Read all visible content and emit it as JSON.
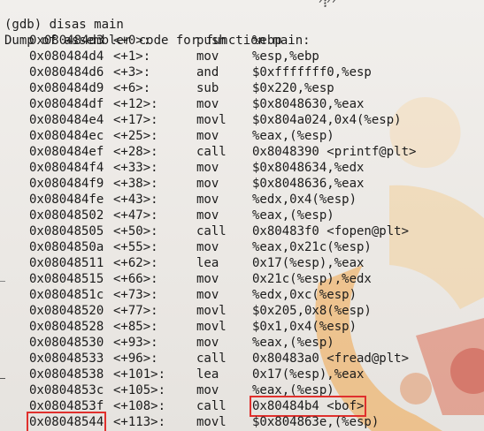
{
  "terminal": {
    "cut_top_text": "ᐟ᎒ᐟᐟ",
    "command_line": "(gdb) disas main",
    "header_line": "Dump of assembler code for function main:",
    "rows": [
      {
        "addr": "0x080484d3",
        "off": "<+0>:",
        "op": "push",
        "args": "%ebp"
      },
      {
        "addr": "0x080484d4",
        "off": "<+1>:",
        "op": "mov",
        "args": "%esp,%ebp"
      },
      {
        "addr": "0x080484d6",
        "off": "<+3>:",
        "op": "and",
        "args": "$0xfffffff0,%esp"
      },
      {
        "addr": "0x080484d9",
        "off": "<+6>:",
        "op": "sub",
        "args": "$0x220,%esp"
      },
      {
        "addr": "0x080484df",
        "off": "<+12>:",
        "op": "mov",
        "args": "$0x8048630,%eax"
      },
      {
        "addr": "0x080484e4",
        "off": "<+17>:",
        "op": "movl",
        "args": "$0x804a024,0x4(%esp)"
      },
      {
        "addr": "0x080484ec",
        "off": "<+25>:",
        "op": "mov",
        "args": "%eax,(%esp)"
      },
      {
        "addr": "0x080484ef",
        "off": "<+28>:",
        "op": "call",
        "args": "0x8048390 <printf@plt>"
      },
      {
        "addr": "0x080484f4",
        "off": "<+33>:",
        "op": "mov",
        "args": "$0x8048634,%edx"
      },
      {
        "addr": "0x080484f9",
        "off": "<+38>:",
        "op": "mov",
        "args": "$0x8048636,%eax"
      },
      {
        "addr": "0x080484fe",
        "off": "<+43>:",
        "op": "mov",
        "args": "%edx,0x4(%esp)"
      },
      {
        "addr": "0x08048502",
        "off": "<+47>:",
        "op": "mov",
        "args": "%eax,(%esp)"
      },
      {
        "addr": "0x08048505",
        "off": "<+50>:",
        "op": "call",
        "args": "0x80483f0 <fopen@plt>"
      },
      {
        "addr": "0x0804850a",
        "off": "<+55>:",
        "op": "mov",
        "args": "%eax,0x21c(%esp)"
      },
      {
        "addr": "0x08048511",
        "off": "<+62>:",
        "op": "lea",
        "args": "0x17(%esp),%eax"
      },
      {
        "addr": "0x08048515",
        "off": "<+66>:",
        "op": "mov",
        "args": "0x21c(%esp),%edx"
      },
      {
        "addr": "0x0804851c",
        "off": "<+73>:",
        "op": "mov",
        "args": "%edx,0xc(%esp)"
      },
      {
        "addr": "0x08048520",
        "off": "<+77>:",
        "op": "movl",
        "args": "$0x205,0x8(%esp)"
      },
      {
        "addr": "0x08048528",
        "off": "<+85>:",
        "op": "movl",
        "args": "$0x1,0x4(%esp)"
      },
      {
        "addr": "0x08048530",
        "off": "<+93>:",
        "op": "mov",
        "args": "%eax,(%esp)"
      },
      {
        "addr": "0x08048533",
        "off": "<+96>:",
        "op": "call",
        "args": "0x80483a0 <fread@plt>"
      },
      {
        "addr": "0x08048538",
        "off": "<+101>:",
        "op": "lea",
        "args": "0x17(%esp),%eax"
      },
      {
        "addr": "0x0804853c",
        "off": "<+105>:",
        "op": "mov",
        "args": "%eax,(%esp)"
      },
      {
        "addr": "0x0804853f",
        "off": "<+108>:",
        "op": "call",
        "args": "0x80484b4 <bof>"
      },
      {
        "addr": "0x08048544",
        "off": "<+113>:",
        "op": "movl",
        "args": "$0x804863e,(%esp)"
      }
    ]
  },
  "highlight_color": "#e0302d"
}
